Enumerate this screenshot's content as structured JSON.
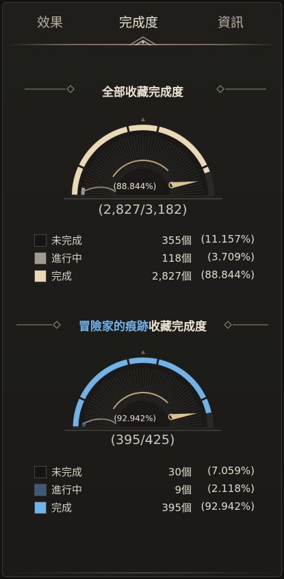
{
  "tabs": [
    {
      "label": "效果",
      "active": false
    },
    {
      "label": "完成度",
      "active": true
    },
    {
      "label": "資訊",
      "active": false
    }
  ],
  "sections": [
    {
      "title_highlight": "",
      "title_rest": "全部收藏完成度",
      "gauge_percent_label": "(88.844%)",
      "gauge_count_label": "(2,827/3,182)",
      "fill_fraction": 0.88844,
      "in_progress_fraction": 0.03709,
      "accent_color": "#ead9b6",
      "legend": [
        {
          "label": "未完成",
          "count": "355個",
          "percent": "(11.157%)",
          "color": "#151515"
        },
        {
          "label": "進行中",
          "count": "118個",
          "percent": "(3.709%)",
          "color": "#a19c93"
        },
        {
          "label": "完成",
          "count": "2,827個",
          "percent": "(88.844%)",
          "color": "#ead9b6"
        }
      ]
    },
    {
      "title_highlight": "冒險家的痕跡",
      "title_rest": "收藏完成度",
      "gauge_percent_label": "(92.942%)",
      "gauge_count_label": "(395/425)",
      "fill_fraction": 0.92942,
      "in_progress_fraction": 0.02118,
      "accent_color": "#6fb3e8",
      "legend": [
        {
          "label": "未完成",
          "count": "30個",
          "percent": "(7.059%)",
          "color": "#151515"
        },
        {
          "label": "進行中",
          "count": "9個",
          "percent": "(2.118%)",
          "color": "#3a5a78"
        },
        {
          "label": "完成",
          "count": "395個",
          "percent": "(92.942%)",
          "color": "#6fb3e8"
        }
      ]
    }
  ]
}
